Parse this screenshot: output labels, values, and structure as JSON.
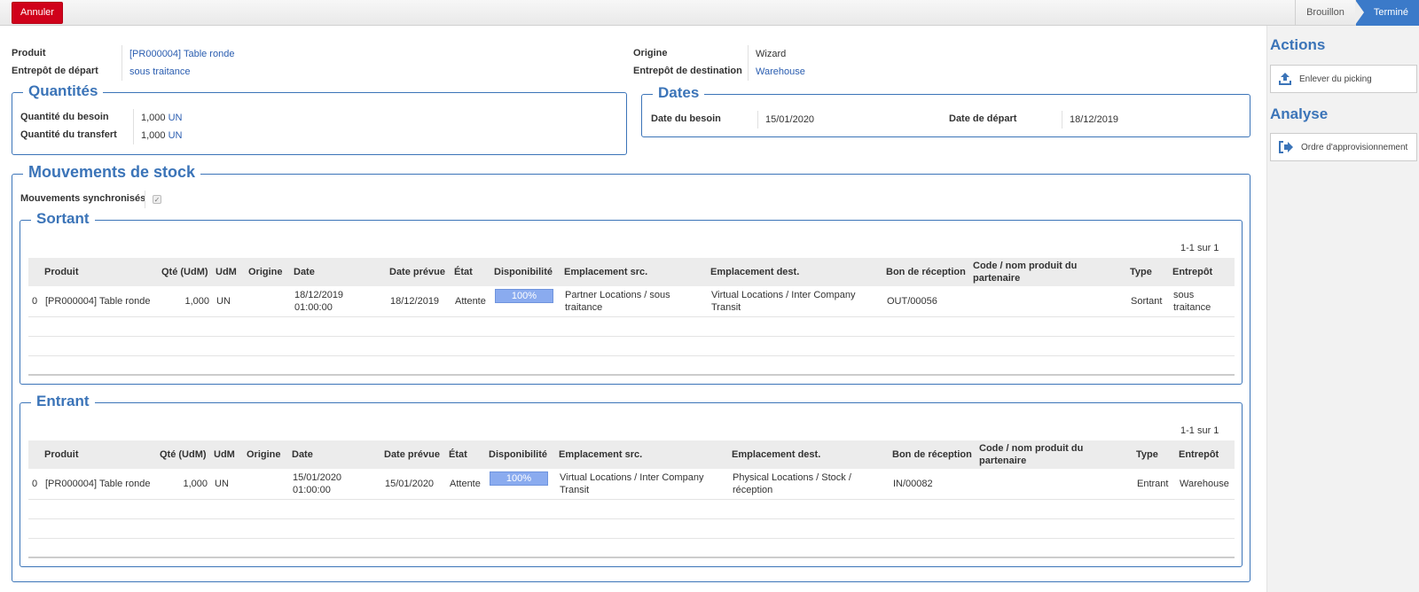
{
  "toolbar": {
    "cancel_label": "Annuler"
  },
  "statusbar": {
    "steps": [
      "Brouillon",
      "Terminé"
    ],
    "active": "Terminé"
  },
  "header": {
    "product_label": "Produit",
    "product_value": "[PR000004] Table ronde",
    "src_wh_label": "Entrepôt de départ",
    "src_wh_value": "sous traitance",
    "origin_label": "Origine",
    "origin_value": "Wizard",
    "dest_wh_label": "Entrepôt de destination",
    "dest_wh_value": "Warehouse"
  },
  "quantities": {
    "title": "Quantités",
    "need_label": "Quantité du besoin",
    "need_value": "1,000",
    "need_uom": "UN",
    "transfer_label": "Quantité du transfert",
    "transfer_value": "1,000",
    "transfer_uom": "UN"
  },
  "dates": {
    "title": "Dates",
    "need_label": "Date du besoin",
    "need_value": "15/01/2020",
    "start_label": "Date de départ",
    "start_value": "18/12/2019"
  },
  "moves": {
    "title": "Mouvements de stock",
    "sync_label": "Mouvements synchronisés",
    "sync_checked": true,
    "columns": [
      "Produit",
      "Qté (UdM)",
      "UdM",
      "Origine",
      "Date",
      "Date prévue",
      "État",
      "Disponibilité",
      "Emplacement src.",
      "Emplacement dest.",
      "Bon de réception",
      "Code / nom produit du partenaire",
      "Type",
      "Entrepôt"
    ],
    "outgoing": {
      "title": "Sortant",
      "pager": "1-1 sur 1",
      "rows": [
        {
          "index": "0",
          "product": "[PR000004] Table ronde",
          "qty": "1,000",
          "uom": "UN",
          "origin": "",
          "date": "18/12/2019 01:00:00",
          "planned": "18/12/2019",
          "state": "Attente",
          "availability": "100%",
          "availability_pct": 100,
          "src": "Partner Locations / sous traitance",
          "dest": "Virtual Locations / Inter Company Transit",
          "receipt": "OUT/00056",
          "partner_code": "",
          "type": "Sortant",
          "warehouse": "sous traitance"
        }
      ]
    },
    "incoming": {
      "title": "Entrant",
      "pager": "1-1 sur 1",
      "rows": [
        {
          "index": "0",
          "product": "[PR000004] Table ronde",
          "qty": "1,000",
          "uom": "UN",
          "origin": "",
          "date": "15/01/2020 01:00:00",
          "planned": "15/01/2020",
          "state": "Attente",
          "availability": "100%",
          "availability_pct": 100,
          "src": "Virtual Locations / Inter Company Transit",
          "dest": "Physical Locations / Stock / réception",
          "receipt": "IN/00082",
          "partner_code": "",
          "type": "Entrant",
          "warehouse": "Warehouse"
        }
      ]
    }
  },
  "sidebar": {
    "actions_title": "Actions",
    "actions": [
      {
        "label": "Enlever du picking",
        "icon": "upload-icon"
      }
    ],
    "analysis_title": "Analyse",
    "analysis": [
      {
        "label": "Ordre d'approvisionnement",
        "icon": "sign-out-icon"
      }
    ]
  },
  "colors": {
    "accent": "#3b74b8",
    "danger": "#d0021b",
    "status_active": "#3b7ac9",
    "availability_bar": "#8aabef"
  }
}
